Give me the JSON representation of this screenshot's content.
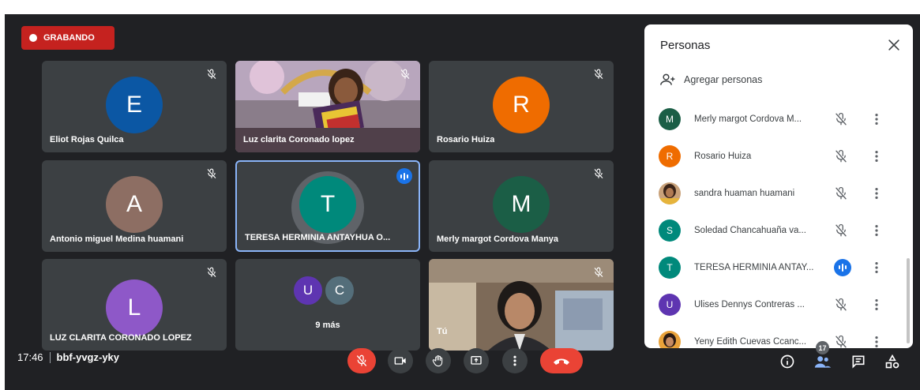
{
  "recording": {
    "label": "GRABANDO"
  },
  "tiles": [
    {
      "name": "Eliot Rojas Quilca",
      "initial": "E",
      "avatar_color": "#0b57a4",
      "muted": true
    },
    {
      "name": "Luz clarita Coronado lopez",
      "video": true,
      "muted": true
    },
    {
      "name": "Rosario Huiza",
      "initial": "R",
      "avatar_color": "#ef6c00",
      "muted": true
    },
    {
      "name": "Antonio miguel Medina huamani",
      "initial": "A",
      "avatar_color": "#8d6e63",
      "muted": true
    },
    {
      "name": "TERESA HERMINIA ANTAYHUA O...",
      "initial": "T",
      "avatar_color": "#00897b",
      "speaking": true
    },
    {
      "name": "Merly margot Cordova Manya",
      "initial": "M",
      "avatar_color": "#1b5e46",
      "muted": true
    },
    {
      "name": "LUZ CLARITA CORONADO LOPEZ",
      "initial": "L",
      "avatar_color": "#8e58c8",
      "muted": true
    },
    {
      "name": "9 más",
      "group": true,
      "initials": [
        "U",
        "C"
      ],
      "colors": [
        "#5e35b1",
        "#546e7a"
      ]
    },
    {
      "name": "Tú",
      "video": true,
      "muted": true
    }
  ],
  "panel": {
    "title": "Personas",
    "add_label": "Agregar personas",
    "participants": [
      {
        "name": "Merly margot Cordova M...",
        "initial": "M",
        "color": "#1b5e46",
        "status": "muted"
      },
      {
        "name": "Rosario Huiza",
        "initial": "R",
        "color": "#ef6c00",
        "status": "muted"
      },
      {
        "name": "sandra huaman huamani",
        "photo": true,
        "status": "muted"
      },
      {
        "name": "Soledad Chancahuaña va...",
        "initial": "S",
        "color": "#00897b",
        "status": "muted"
      },
      {
        "name": "TERESA HERMINIA ANTAY...",
        "initial": "T",
        "color": "#00897b",
        "status": "speaking"
      },
      {
        "name": "Ulises Dennys Contreras ...",
        "initial": "U",
        "color": "#5e35b1",
        "status": "muted"
      },
      {
        "name": "Yeny Edith Cuevas Ccanc...",
        "photo": true,
        "status": "muted"
      }
    ]
  },
  "bottom": {
    "time": "17:46",
    "meeting_code": "bbf-yvgz-yky",
    "people_count": "17"
  },
  "colors": {
    "background": "#202124",
    "tile": "#3c4043",
    "accent": "#1a73e8",
    "danger": "#ea4335"
  }
}
